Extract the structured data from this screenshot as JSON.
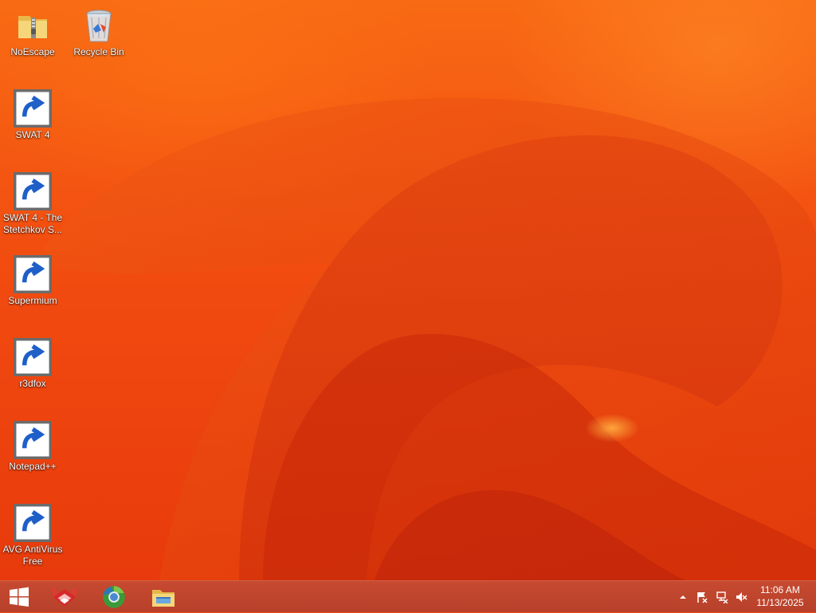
{
  "desktop": {
    "icons": [
      {
        "id": "noescape",
        "label": "NoEscape",
        "icon": "zip-folder-icon"
      },
      {
        "id": "recycle-bin",
        "label": "Recycle Bin",
        "icon": "recycle-bin-icon"
      },
      {
        "id": "swat4",
        "label": "SWAT 4",
        "icon": "swat4-icon"
      },
      {
        "id": "swat4-stetchkov",
        "label": "SWAT 4 - The\nStetchkov S...",
        "icon": "swat4-icon"
      },
      {
        "id": "supermium",
        "label": "Supermium",
        "icon": "supermium-icon"
      },
      {
        "id": "r3dfox",
        "label": "r3dfox",
        "icon": "r3dfox-icon"
      },
      {
        "id": "notepadpp",
        "label": "Notepad++",
        "icon": "notepadpp-icon"
      },
      {
        "id": "avg",
        "label": "AVG AntiVirus\nFree",
        "icon": "avg-icon"
      }
    ]
  },
  "taskbar": {
    "start_icon": "windows-logo-icon",
    "pinned": [
      "r3dfox-icon",
      "supermium-icon",
      "file-explorer-icon"
    ],
    "tray": [
      "show-hidden-icons-chevron",
      "action-center-flag-icon",
      "network-icon",
      "volume-muted-icon"
    ],
    "clock": {
      "time": "11:06 AM",
      "date": "11/13/2025"
    }
  },
  "colors": {
    "wallpaper": "#f04a12",
    "taskbar": "#bd442c"
  }
}
